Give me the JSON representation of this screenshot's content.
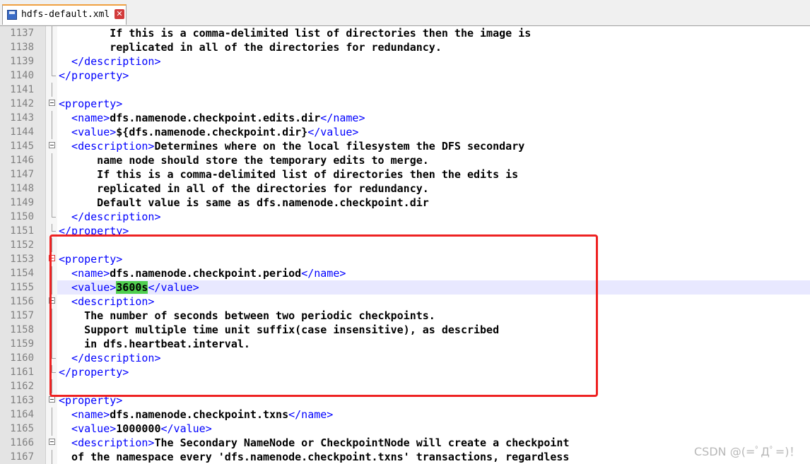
{
  "tab": {
    "file_name": "hdfs-default.xml",
    "icon": "save-disk-icon",
    "close_icon": "close-icon"
  },
  "editor": {
    "lines": [
      {
        "n": "1137",
        "segments": [
          {
            "t": "        If this is a comma-delimited list of directories then the image is",
            "c": "txt"
          }
        ]
      },
      {
        "n": "1138",
        "segments": [
          {
            "t": "        replicated in all of the directories for redundancy.",
            "c": "txt"
          }
        ]
      },
      {
        "n": "1139",
        "segments": [
          {
            "t": "  </description>",
            "c": "tag"
          }
        ]
      },
      {
        "n": "1140",
        "segments": [
          {
            "t": "</property>",
            "c": "tag"
          }
        ]
      },
      {
        "n": "1141",
        "segments": []
      },
      {
        "n": "1142",
        "segments": [
          {
            "t": "<property>",
            "c": "tag"
          }
        ]
      },
      {
        "n": "1143",
        "segments": [
          {
            "t": "  <name>",
            "c": "tag"
          },
          {
            "t": "dfs.namenode.checkpoint.edits.dir",
            "c": "txt"
          },
          {
            "t": "</name>",
            "c": "tag"
          }
        ]
      },
      {
        "n": "1144",
        "segments": [
          {
            "t": "  <value>",
            "c": "tag"
          },
          {
            "t": "${dfs.namenode.checkpoint.dir}",
            "c": "txt"
          },
          {
            "t": "</value>",
            "c": "tag"
          }
        ]
      },
      {
        "n": "1145",
        "segments": [
          {
            "t": "  <description>",
            "c": "tag"
          },
          {
            "t": "Determines where on the local filesystem the DFS secondary",
            "c": "txt"
          }
        ]
      },
      {
        "n": "1146",
        "segments": [
          {
            "t": "      name node should store the temporary edits to merge.",
            "c": "txt"
          }
        ]
      },
      {
        "n": "1147",
        "segments": [
          {
            "t": "      If this is a comma-delimited list of directories then the edits is",
            "c": "txt"
          }
        ]
      },
      {
        "n": "1148",
        "segments": [
          {
            "t": "      replicated in all of the directories for redundancy.",
            "c": "txt"
          }
        ]
      },
      {
        "n": "1149",
        "segments": [
          {
            "t": "      Default value is same as dfs.namenode.checkpoint.dir",
            "c": "txt"
          }
        ]
      },
      {
        "n": "1150",
        "segments": [
          {
            "t": "  </description>",
            "c": "tag"
          }
        ]
      },
      {
        "n": "1151",
        "segments": [
          {
            "t": "</property>",
            "c": "tag"
          }
        ]
      },
      {
        "n": "1152",
        "segments": []
      },
      {
        "n": "1153",
        "segments": [
          {
            "t": "<property>",
            "c": "tag"
          }
        ]
      },
      {
        "n": "1154",
        "segments": [
          {
            "t": "  <name>",
            "c": "tag"
          },
          {
            "t": "dfs.namenode.checkpoint.period",
            "c": "txt"
          },
          {
            "t": "</name>",
            "c": "tag"
          }
        ]
      },
      {
        "n": "1155",
        "segments": [
          {
            "t": "  <value>",
            "c": "tag"
          },
          {
            "t": "3600s",
            "c": "txt sel"
          },
          {
            "t": "</value>",
            "c": "tag"
          }
        ]
      },
      {
        "n": "1156",
        "segments": [
          {
            "t": "  <description>",
            "c": "tag"
          }
        ]
      },
      {
        "n": "1157",
        "segments": [
          {
            "t": "    The number of seconds between two periodic checkpoints.",
            "c": "txt"
          }
        ]
      },
      {
        "n": "1158",
        "segments": [
          {
            "t": "    Support multiple time unit suffix(case insensitive), as described",
            "c": "txt"
          }
        ]
      },
      {
        "n": "1159",
        "segments": [
          {
            "t": "    in dfs.heartbeat.interval.",
            "c": "txt"
          }
        ]
      },
      {
        "n": "1160",
        "segments": [
          {
            "t": "  </description>",
            "c": "tag"
          }
        ]
      },
      {
        "n": "1161",
        "segments": [
          {
            "t": "</property>",
            "c": "tag"
          }
        ]
      },
      {
        "n": "1162",
        "segments": []
      },
      {
        "n": "1163",
        "segments": [
          {
            "t": "<property>",
            "c": "tag"
          }
        ]
      },
      {
        "n": "1164",
        "segments": [
          {
            "t": "  <name>",
            "c": "tag"
          },
          {
            "t": "dfs.namenode.checkpoint.txns",
            "c": "txt"
          },
          {
            "t": "</name>",
            "c": "tag"
          }
        ]
      },
      {
        "n": "1165",
        "segments": [
          {
            "t": "  <value>",
            "c": "tag"
          },
          {
            "t": "1000000",
            "c": "txt"
          },
          {
            "t": "</value>",
            "c": "tag"
          }
        ]
      },
      {
        "n": "1166",
        "segments": [
          {
            "t": "  <description>",
            "c": "tag"
          },
          {
            "t": "The Secondary NameNode or CheckpointNode will create a checkpoint",
            "c": "txt"
          }
        ]
      },
      {
        "n": "1167",
        "segments": [
          {
            "t": "  of the namespace every 'dfs.namenode.checkpoint.txns' transactions, regardless",
            "c": "txt"
          }
        ]
      }
    ]
  },
  "watermark": "CSDN @(=ﾟДﾟ=)！",
  "colors": {
    "tag": "#0000ff",
    "text": "#000000",
    "highlight_box": "#ee2222",
    "selection": "#4fcf4f",
    "current_line": "#e8e8ff"
  }
}
